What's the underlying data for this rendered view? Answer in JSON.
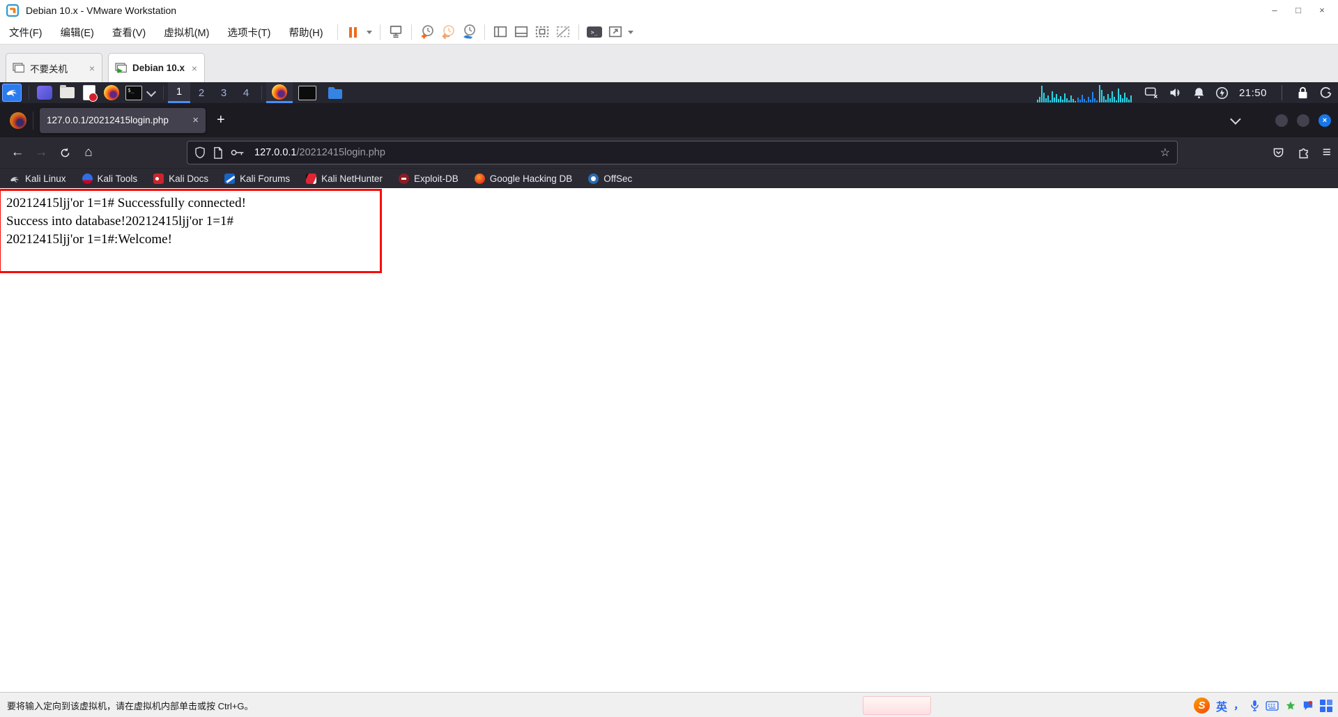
{
  "vmware": {
    "window_title": "Debian 10.x - VMware Workstation",
    "menu_items": [
      "文件(F)",
      "编辑(E)",
      "查看(V)",
      "虚拟机(M)",
      "选项卡(T)",
      "帮助(H)"
    ],
    "window_controls": {
      "minimize": "–",
      "maximize": "□",
      "close": "×"
    },
    "vm_tabs": [
      {
        "label": "不要关机",
        "state": "inactive"
      },
      {
        "label": "Debian 10.x",
        "state": "active"
      }
    ],
    "status_hint": "要将输入定向到该虚拟机，请在虚拟机内部单击或按 Ctrl+G。"
  },
  "kali": {
    "workspaces": [
      "1",
      "2",
      "3",
      "4"
    ],
    "active_workspace": "1",
    "clock": "21:50"
  },
  "firefox": {
    "tab_title": "127.0.0.1/20212415login.php",
    "url_host": "127.0.0.1",
    "url_path": "/20212415login.php",
    "bookmarks": [
      {
        "label": "Kali Linux"
      },
      {
        "label": "Kali Tools"
      },
      {
        "label": "Kali Docs"
      },
      {
        "label": "Kali Forums"
      },
      {
        "label": "Kali NetHunter"
      },
      {
        "label": "Exploit-DB"
      },
      {
        "label": "Google Hacking DB"
      },
      {
        "label": "OffSec"
      }
    ]
  },
  "page": {
    "lines": [
      "20212415ljj'or 1=1# Successfully connected!",
      "Success into database!20212415ljj'or 1=1#",
      "20212415ljj'or 1=1#:Welcome!"
    ]
  },
  "ime": {
    "logo": "S",
    "lang_indicator": "英",
    "punct": "，"
  },
  "glyphs": {
    "close": "×",
    "plus": "+",
    "back": "←",
    "forward": "→",
    "home": "⌂",
    "star": "☆",
    "hamburger": "≡",
    "console_prompt": ">_",
    "terminal_prompt": "$_"
  },
  "colors": {
    "vmware_accent_orange": "#ee6b1e",
    "kali_panel_bg": "#262630",
    "kali_accent_blue": "#4a8df8",
    "firefox_dark_bg": "#1c1b22",
    "firefox_toolbar_bg": "#2b2a33",
    "firefox_close_dot": "#1877e8",
    "result_border_red": "#f80b06",
    "ime_blue": "#2e6cf6"
  }
}
